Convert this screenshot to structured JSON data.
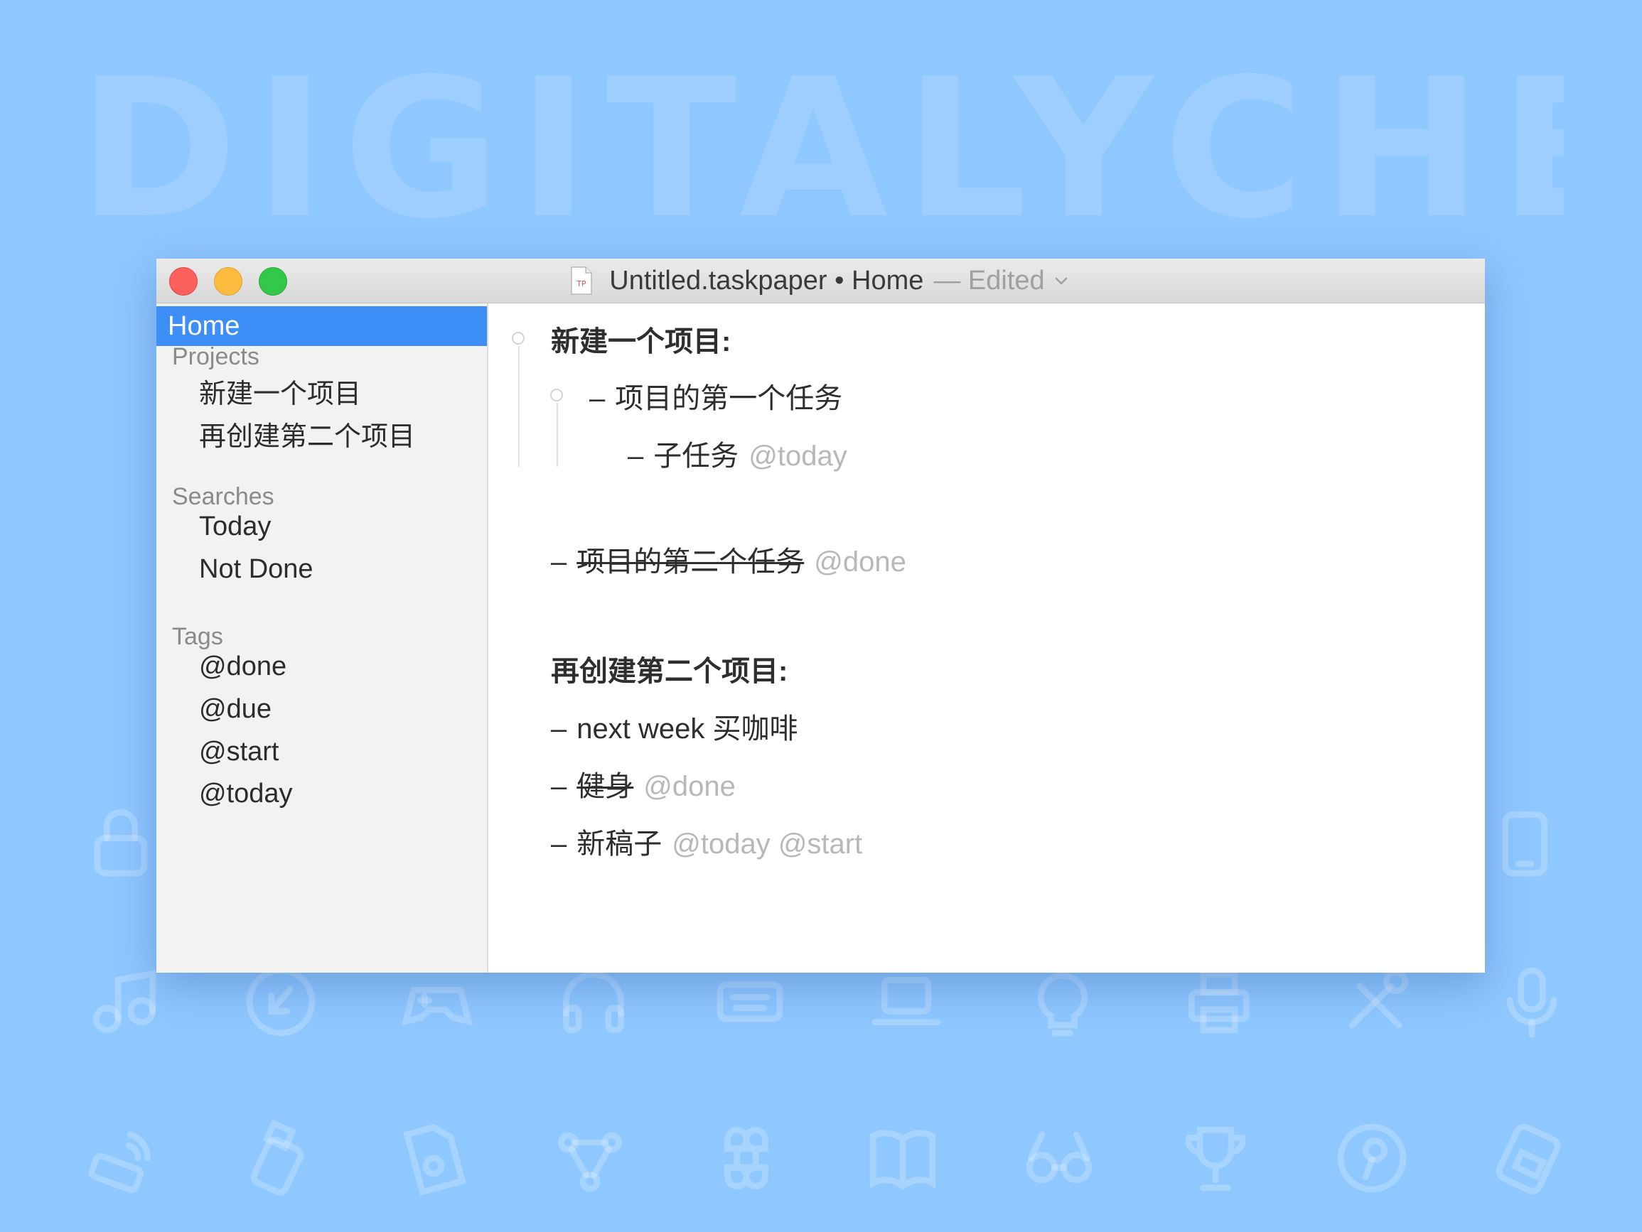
{
  "background": {
    "watermark": "DIGITALYCHEE",
    "color": "#8fc7ff",
    "icons": [
      "lock-icon",
      "music-icon",
      "download-icon",
      "gamepad-icon",
      "headphones-icon",
      "keyboard-icon",
      "laptop-icon",
      "lightbulb-icon",
      "printer-icon",
      "tools-icon",
      "microphone-icon",
      "wifi-icon",
      "usb-drive-icon",
      "document-icon",
      "network-icon",
      "command-key-icon",
      "book-icon",
      "glasses-icon",
      "trophy-icon",
      "key-icon",
      "disk-icon",
      "phone-icon"
    ]
  },
  "window": {
    "title": "Untitled.taskpaper • Home",
    "edited": "— Edited",
    "doc_icon_label": "TP"
  },
  "sidebar": {
    "home": "Home",
    "sections": [
      {
        "header": "Projects",
        "items": [
          "新建一个项目",
          "再创建第二个项目"
        ]
      },
      {
        "header": "Searches",
        "items": [
          "Today",
          "Not Done"
        ]
      },
      {
        "header": "Tags",
        "items": [
          "@done",
          "@due",
          "@start",
          "@today"
        ]
      }
    ]
  },
  "editor": {
    "projects": [
      {
        "title": "新建一个项目:",
        "tasks": [
          {
            "text": "项目的第一个任务",
            "tags": "",
            "done": false
          },
          {
            "text": "子任务",
            "tags": "@today",
            "done": false,
            "indent": 2
          },
          {
            "text": "项目的第二个任务",
            "tags": "@done",
            "done": true
          }
        ]
      },
      {
        "title": "再创建第二个项目:",
        "tasks": [
          {
            "text": "next week 买咖啡",
            "tags": "",
            "done": false
          },
          {
            "text": "健身",
            "tags": "@done",
            "done": true
          },
          {
            "text": "新稿子",
            "tags": "@today @start",
            "done": false
          }
        ]
      }
    ],
    "dash": "–"
  },
  "colors": {
    "selection": "#3d8ef7",
    "tag": "#b8b8b8",
    "close": "#fc605c",
    "minimize": "#fdbc40",
    "zoom": "#34c84a"
  }
}
